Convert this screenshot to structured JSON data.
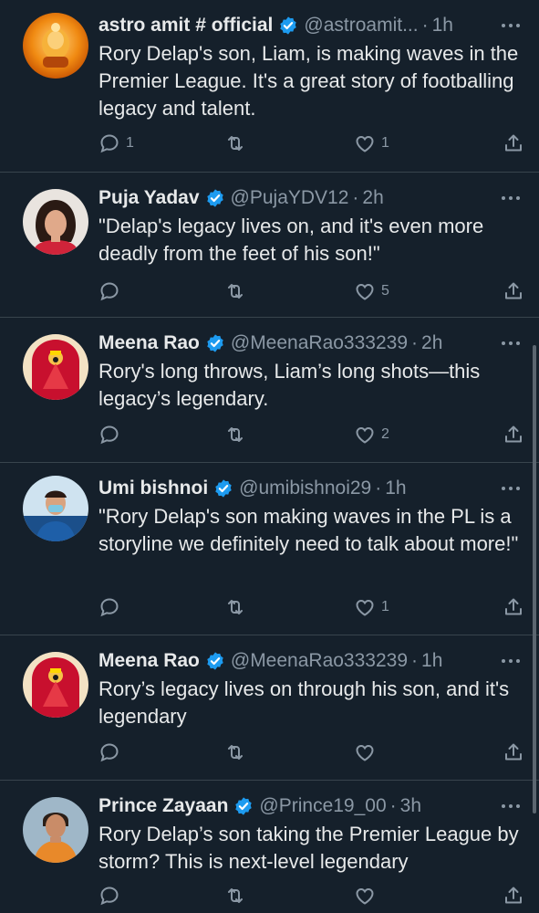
{
  "colors": {
    "background": "#15202b",
    "text": "#e7e9ea",
    "muted": "#8b98a5",
    "verified": "#1d9bf0",
    "divider": "#38444d"
  },
  "tweets": [
    {
      "name": "astro amit # official",
      "handle": "@astroamit...",
      "dot": "·",
      "time": "1h",
      "text": "Rory Delap's son, Liam, is making waves in the Premier League. It's a great story of footballing legacy and talent.",
      "replies": "1",
      "retweets": "",
      "likes": "1",
      "avatar": "orange-deity-avatar"
    },
    {
      "name": "Puja Yadav",
      "handle": "@PujaYDV12",
      "dot": "·",
      "time": "2h",
      "text": "\"Delap's legacy lives on, and it's even more deadly from the feet of his son!\"",
      "replies": "",
      "retweets": "",
      "likes": "5",
      "avatar": "woman-portrait-avatar"
    },
    {
      "name": "Meena Rao",
      "handle": "@MeenaRao333239",
      "dot": "·",
      "time": "2h",
      "text": "Rory's long throws, Liam’s long shots—this legacy’s legendary.",
      "replies": "",
      "retweets": "",
      "likes": "2",
      "avatar": "red-deity-avatar"
    },
    {
      "name": "Umi bishnoi",
      "handle": "@umibishnoi29",
      "dot": "·",
      "time": "1h",
      "text": "\"Rory Delap's son making waves in the PL is a storyline we definitely need to talk about more!\"",
      "replies": "",
      "retweets": "",
      "likes": "1",
      "avatar": "nurse-portrait-avatar"
    },
    {
      "name": "Meena Rao",
      "handle": "@MeenaRao333239",
      "dot": "·",
      "time": "1h",
      "text": "Rory’s legacy lives on through his son, and it's legendary",
      "replies": "",
      "retweets": "",
      "likes": "",
      "avatar": "red-deity-avatar"
    },
    {
      "name": "Prince Zayaan",
      "handle": "@Prince19_00",
      "dot": "·",
      "time": "3h",
      "text": "Rory Delap’s son taking the Premier League by storm? This is next-level legendary",
      "replies": "",
      "retweets": "",
      "likes": "",
      "avatar": "man-portrait-avatar"
    }
  ]
}
